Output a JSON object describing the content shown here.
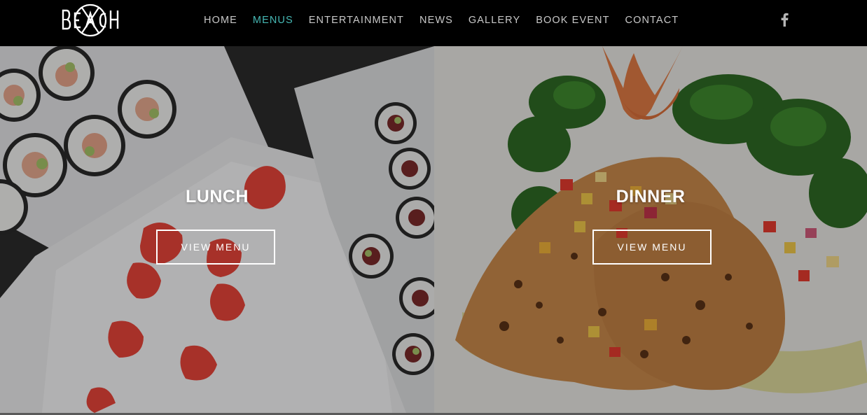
{
  "brand": {
    "logo_text": "BEACH",
    "logo_color": "#ffffff"
  },
  "nav": {
    "items": [
      {
        "label": "HOME",
        "active": false
      },
      {
        "label": "MENUS",
        "active": true
      },
      {
        "label": "ENTERTAINMENT",
        "active": false
      },
      {
        "label": "NEWS",
        "active": false
      },
      {
        "label": "GALLERY",
        "active": false
      },
      {
        "label": "BOOK EVENT",
        "active": false
      },
      {
        "label": "CONTACT",
        "active": false
      }
    ],
    "active_color": "#46b8b4",
    "text_color": "#c8c8c8"
  },
  "social": {
    "icon": "facebook-icon"
  },
  "panels": {
    "lunch": {
      "title": "LUNCH",
      "button_label": "VIEW MENU",
      "image": "sushi-rolls-and-pickled-ginger-photo"
    },
    "dinner": {
      "title": "DINNER",
      "button_label": "VIEW MENU",
      "image": "grilled-fish-with-broccolini-and-salsa-photo"
    }
  }
}
